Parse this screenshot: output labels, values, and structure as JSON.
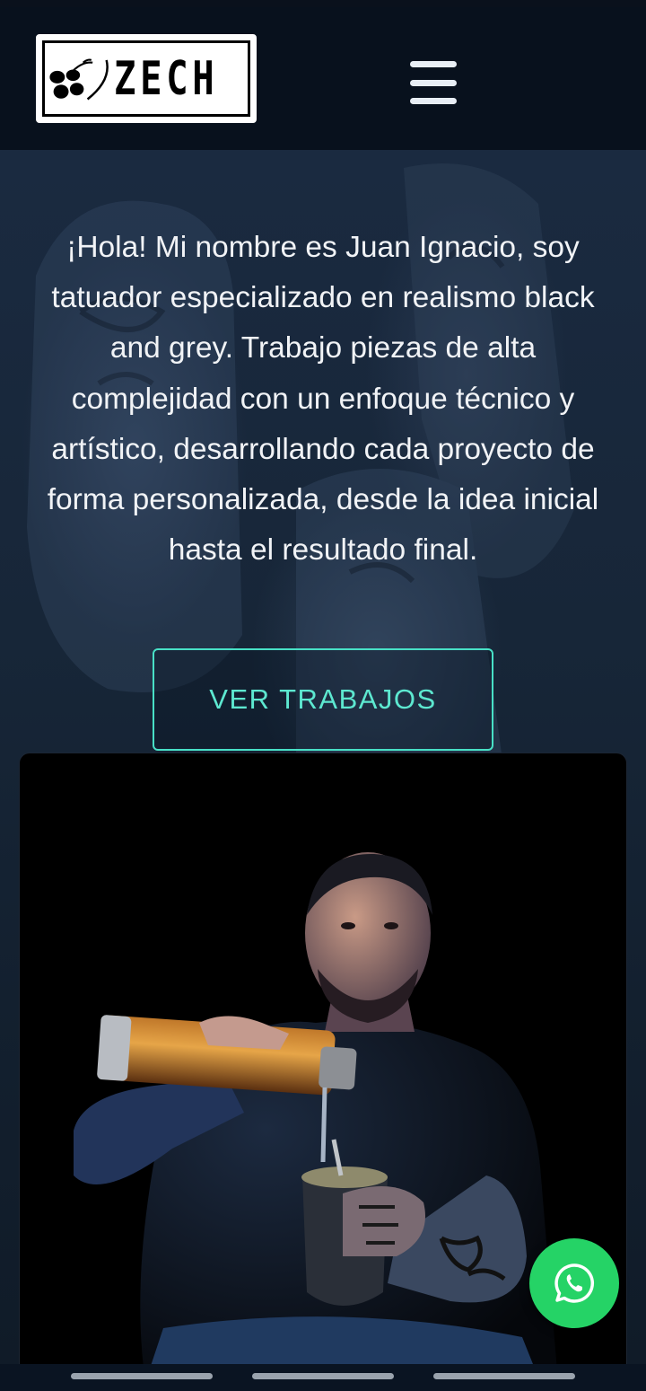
{
  "brand": {
    "logo_text": "ZECH"
  },
  "header": {
    "menu_icon": "hamburger-menu-icon"
  },
  "hero": {
    "intro_text": "¡Hola! Mi nombre es Juan Ignacio, soy tatuador especializado en realismo black and grey. Trabajo piezas de alta complejidad con un enfoque técnico y artístico, desarrollando cada proyecto de forma personalizada, desde la idea inicial hasta el resultado final.",
    "cta_label": "VER TRABAJOS"
  },
  "photo": {
    "icon": "portrait-photo"
  },
  "floating": {
    "whatsapp_icon": "whatsapp-icon"
  },
  "colors": {
    "accent": "#48e0c6",
    "whatsapp": "#25d366",
    "header_bg": "#08111d"
  }
}
